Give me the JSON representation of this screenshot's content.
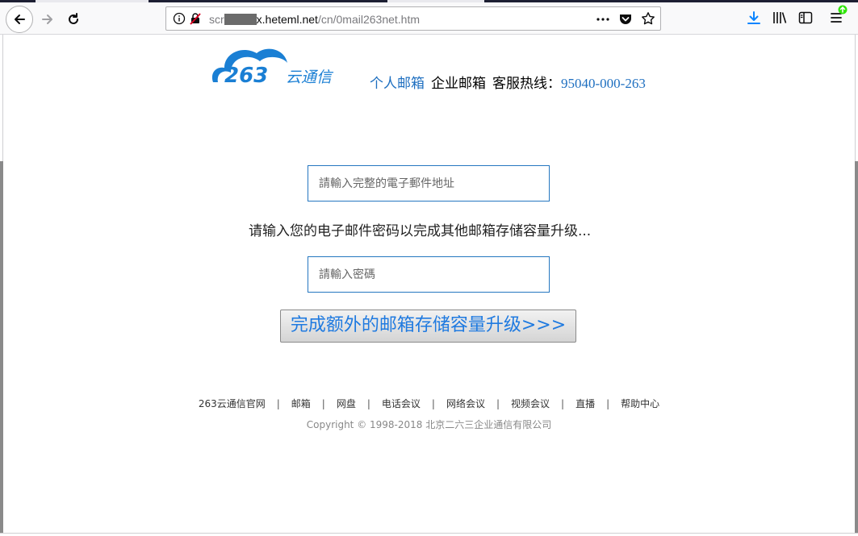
{
  "browser": {
    "url_prefix": "scr",
    "url_host": "x.heteml.net",
    "url_path": "/cn/0mail263net.htm"
  },
  "header": {
    "logo_text": "263云通信",
    "personal_mail": "个人邮箱",
    "enterprise_mail": "企业邮箱",
    "hotline_label": "客服热线：",
    "hotline_number": "95040-000-263"
  },
  "form": {
    "email_placeholder": "請輸入完整的電子郵件地址",
    "prompt": "请输入您的电子邮件密码以完成其他邮箱存储容量升级...",
    "password_placeholder": "請輸入密碼",
    "submit_label": "完成额外的邮箱存储容量升级>>>"
  },
  "footer": {
    "links": [
      "263云通信官网",
      "邮箱",
      "网盘",
      "电话会议",
      "网络会议",
      "视频会议",
      "直播",
      "帮助中心"
    ],
    "copyright": "Copyright © 1998-2018 北京二六三企业通信有限公司"
  },
  "colors": {
    "brand_blue": "#1e6fc0",
    "button_text": "#1f7ae0",
    "input_border": "#2577c0"
  }
}
